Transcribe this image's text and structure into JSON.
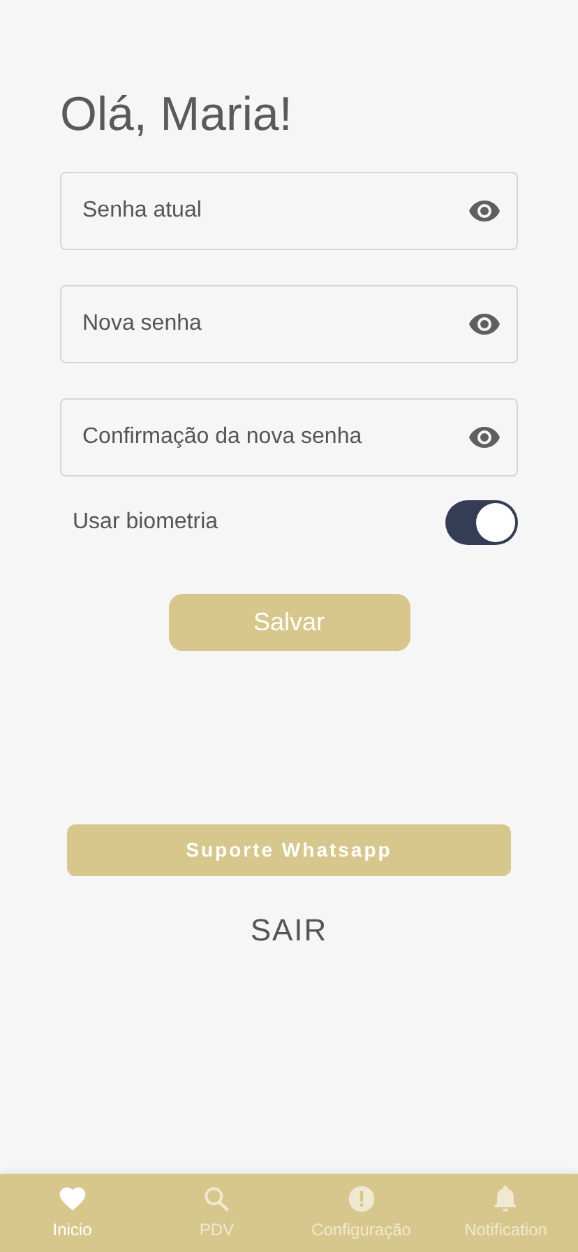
{
  "greeting": "Olá, Maria!",
  "fields": [
    {
      "placeholder": "Senha atual"
    },
    {
      "placeholder": "Nova senha"
    },
    {
      "placeholder": "Confirmação da nova senha"
    }
  ],
  "biometrics": {
    "label": "Usar biometria",
    "on": true
  },
  "save_button": "Salvar",
  "support_button": "Suporte Whatsapp",
  "logout_link": "SAIR",
  "bottom_nav": [
    {
      "label": "Inicio",
      "kind": "heart",
      "selected": true
    },
    {
      "label": "PDV",
      "kind": "search",
      "selected": false
    },
    {
      "label": "Configuração",
      "kind": "alert",
      "selected": false
    },
    {
      "label": "Notification",
      "kind": "bell",
      "selected": false
    }
  ]
}
